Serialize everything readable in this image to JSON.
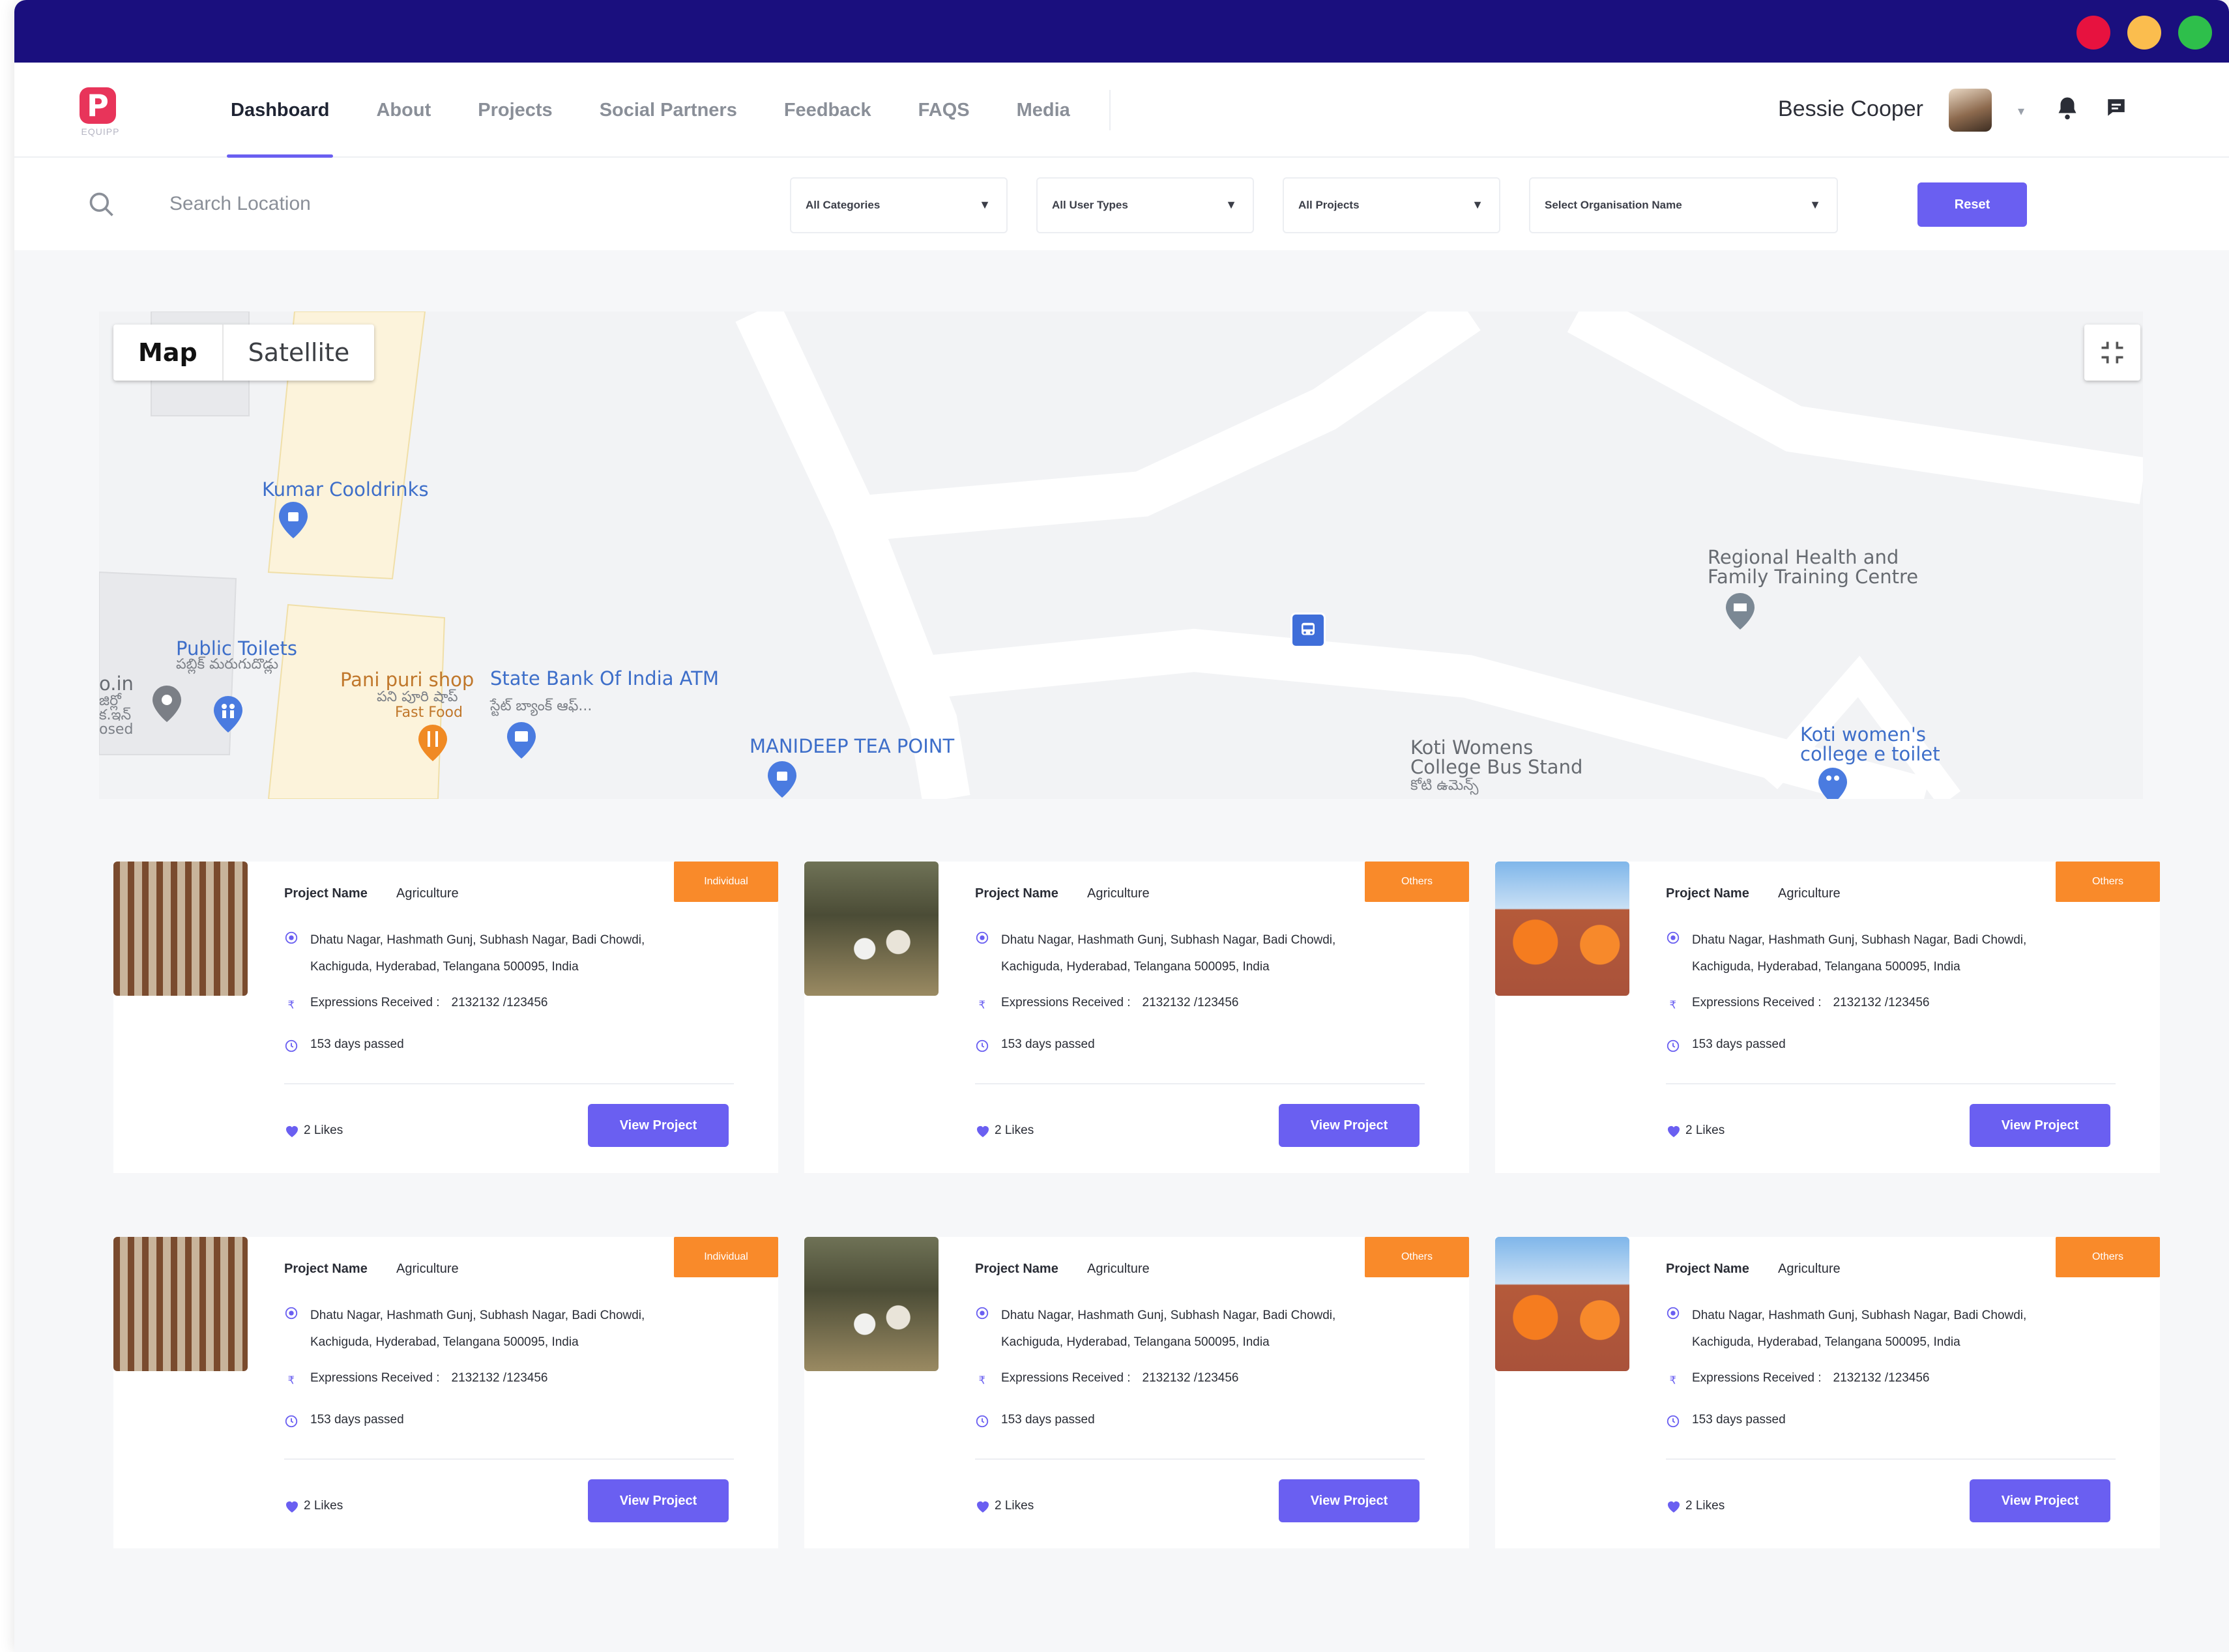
{
  "app": {
    "logo_letter": "P",
    "logo_sub": "EQUIPP"
  },
  "nav": {
    "items": [
      {
        "label": "Dashboard",
        "active": true
      },
      {
        "label": "About"
      },
      {
        "label": "Projects"
      },
      {
        "label": "Social Partners"
      },
      {
        "label": "Feedback"
      },
      {
        "label": "FAQS"
      },
      {
        "label": "Media"
      }
    ],
    "user_name": "Bessie Cooper"
  },
  "filters": {
    "search_placeholder": "Search Location",
    "category": "All Categories",
    "user_type": "All User Types",
    "project": "All Projects",
    "organisation": "Select Organisation Name",
    "reset_label": "Reset"
  },
  "map": {
    "type_options": [
      "Map",
      "Satellite"
    ],
    "pois": [
      {
        "name": "Kumar Cooldrinks"
      },
      {
        "name": "Public Toilets",
        "sub": "పబ్లిక్ మరుగుదొడ్లు"
      },
      {
        "name": "Pani puri shop",
        "sub": "పని పూరి షాప్",
        "sub2": "Fast Food"
      },
      {
        "name": "State Bank Of India ATM",
        "sub": "స్టేట్ బ్యాంక్ ఆఫ్..."
      },
      {
        "name": "MANIDEEP TEA POINT"
      },
      {
        "name": "Regional Health and",
        "name2": "Family Training Centre"
      },
      {
        "name": "Koti Womens",
        "name2": "College Bus Stand",
        "sub": "కోటి ఉమెన్స్"
      },
      {
        "name": "Koti women's",
        "name2": "college e toilet"
      },
      {
        "name": "o.in",
        "sub": "జిర్లో",
        "sub2": "క.ఇన్",
        "sub3": "osed"
      }
    ]
  },
  "projects": [
    {
      "tag": "Individual",
      "name_label": "Project Name",
      "name": "Agriculture",
      "address_line1": "Dhatu Nagar, Hashmath Gunj, Subhash Nagar, Badi Chowdi,",
      "address_line2": "Kachiguda, Hyderabad, Telangana 500095, India",
      "expressions_label": "Expressions Received :",
      "expressions": "2132132 /123456",
      "days": "153  days passed",
      "likes": "2 Likes",
      "button": "View Project",
      "image": "construction-scaffold"
    },
    {
      "tag": "Others",
      "name_label": "Project Name",
      "name": "Agriculture",
      "address_line1": "Dhatu Nagar, Hashmath Gunj, Subhash Nagar, Badi Chowdi,",
      "address_line2": "Kachiguda, Hyderabad, Telangana 500095, India",
      "expressions_label": "Expressions Received :",
      "expressions": "2132132 /123456",
      "days": "153  days passed",
      "likes": "2 Likes",
      "button": "View Project",
      "image": "excavation-site"
    },
    {
      "tag": "Others",
      "name_label": "Project Name",
      "name": "Agriculture",
      "address_line1": "Dhatu Nagar, Hashmath Gunj, Subhash Nagar, Badi Chowdi,",
      "address_line2": "Kachiguda, Hyderabad, Telangana 500095, India",
      "expressions_label": "Expressions Received :",
      "expressions": "2132132 /123456",
      "days": "153  days passed",
      "likes": "2 Likes",
      "button": "View Project",
      "image": "rooftop-engineers"
    },
    {
      "tag": "Individual",
      "name_label": "Project Name",
      "name": "Agriculture",
      "address_line1": "Dhatu Nagar, Hashmath Gunj, Subhash Nagar, Badi Chowdi,",
      "address_line2": "Kachiguda, Hyderabad, Telangana 500095, India",
      "expressions_label": "Expressions Received :",
      "expressions": "2132132 /123456",
      "days": "153  days passed",
      "likes": "2 Likes",
      "button": "View Project",
      "image": "construction-scaffold"
    },
    {
      "tag": "Others",
      "name_label": "Project Name",
      "name": "Agriculture",
      "address_line1": "Dhatu Nagar, Hashmath Gunj, Subhash Nagar, Badi Chowdi,",
      "address_line2": "Kachiguda, Hyderabad, Telangana 500095, India",
      "expressions_label": "Expressions Received :",
      "expressions": "2132132 /123456",
      "days": "153  days passed",
      "likes": "2 Likes",
      "button": "View Project",
      "image": "excavation-site"
    },
    {
      "tag": "Others",
      "name_label": "Project Name",
      "name": "Agriculture",
      "address_line1": "Dhatu Nagar, Hashmath Gunj, Subhash Nagar, Badi Chowdi,",
      "address_line2": "Kachiguda, Hyderabad, Telangana 500095, India",
      "expressions_label": "Expressions Received :",
      "expressions": "2132132 /123456",
      "days": "153  days passed",
      "likes": "2 Likes",
      "button": "View Project",
      "image": "rooftop-engineers"
    }
  ],
  "colors": {
    "titlebar": "#1a0f7e",
    "accent": "#6a5ff1",
    "tag_orange": "#f98a2a",
    "traffic_red": "#e7123f",
    "traffic_yellow": "#fbbd4e",
    "traffic_green": "#2ebf4b"
  }
}
